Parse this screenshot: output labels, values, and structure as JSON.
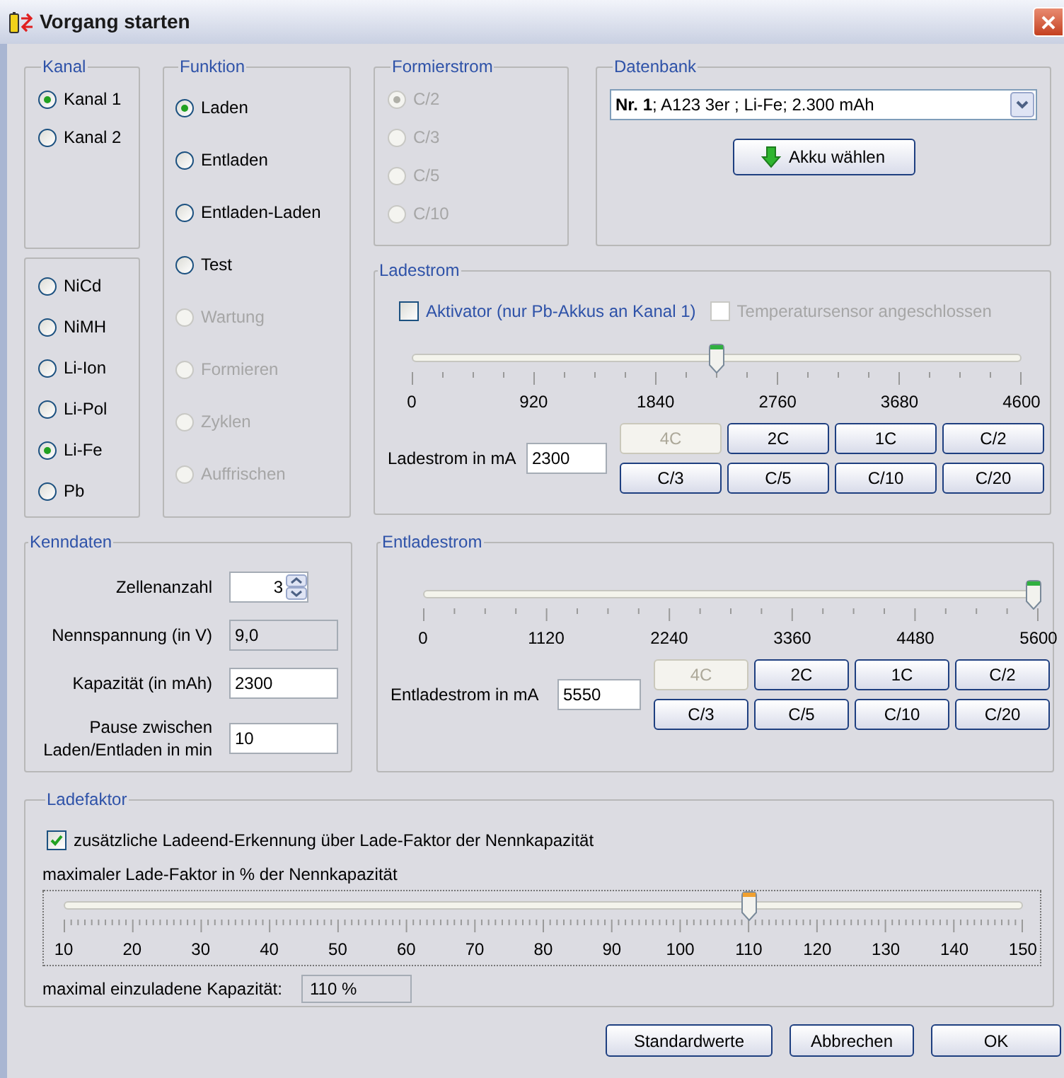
{
  "window": {
    "title": "Vorgang starten"
  },
  "kanal": {
    "title": "Kanal",
    "options": [
      {
        "label": "Kanal 1",
        "selected": true,
        "disabled": false
      },
      {
        "label": "Kanal 2",
        "selected": false,
        "disabled": false
      }
    ]
  },
  "akku_typ": {
    "options": [
      {
        "label": "NiCd",
        "selected": false,
        "disabled": false
      },
      {
        "label": "NiMH",
        "selected": false,
        "disabled": false
      },
      {
        "label": "Li-Ion",
        "selected": false,
        "disabled": false
      },
      {
        "label": "Li-Pol",
        "selected": false,
        "disabled": false
      },
      {
        "label": "Li-Fe",
        "selected": true,
        "disabled": false
      },
      {
        "label": "Pb",
        "selected": false,
        "disabled": false
      }
    ]
  },
  "funktion": {
    "title": "Funktion",
    "options": [
      {
        "label": "Laden",
        "selected": true,
        "disabled": false
      },
      {
        "label": "Entladen",
        "selected": false,
        "disabled": false
      },
      {
        "label": "Entladen-Laden",
        "selected": false,
        "disabled": false
      },
      {
        "label": "Test",
        "selected": false,
        "disabled": false
      },
      {
        "label": "Wartung",
        "selected": false,
        "disabled": true
      },
      {
        "label": "Formieren",
        "selected": false,
        "disabled": true
      },
      {
        "label": "Zyklen",
        "selected": false,
        "disabled": true
      },
      {
        "label": "Auffrischen",
        "selected": false,
        "disabled": true
      }
    ]
  },
  "formierstrom": {
    "title": "Formierstrom",
    "options": [
      {
        "label": "C/2",
        "selected": true,
        "disabled": true
      },
      {
        "label": "C/3",
        "selected": false,
        "disabled": true
      },
      {
        "label": "C/5",
        "selected": false,
        "disabled": true
      },
      {
        "label": "C/10",
        "selected": false,
        "disabled": true
      }
    ]
  },
  "datenbank": {
    "title": "Datenbank",
    "select": {
      "value": "**Nr. 1**; A123 3er ; Li-Fe; 2.300 mAh"
    },
    "button": "Akku wählen"
  },
  "ladestrom": {
    "title": "Ladestrom",
    "checkboxes": [
      {
        "label": "Aktivator (nur Pb-Akkus an Kanal 1)",
        "checked": false,
        "disabled": false
      },
      {
        "label": "Temperatursensor angeschlossen",
        "checked": false,
        "disabled": true
      }
    ],
    "slider": {
      "level": 0.5,
      "focused": false,
      "ticks": [
        "0",
        "920",
        "1840",
        "2760",
        "3680",
        "4600"
      ]
    },
    "field_label": "Ladestrom in mA",
    "value": "2300",
    "buttons": [
      {
        "label": "4C",
        "disabled": true
      },
      {
        "label": "2C",
        "disabled": false
      },
      {
        "label": "1C",
        "disabled": false
      },
      {
        "label": "C/2",
        "disabled": false
      },
      {
        "label": "C/3",
        "disabled": false
      },
      {
        "label": "C/5",
        "disabled": false
      },
      {
        "label": "C/10",
        "disabled": false
      },
      {
        "label": "C/20",
        "disabled": false
      }
    ]
  },
  "kenndaten": {
    "title": "Kenndaten",
    "fields": [
      {
        "label": "Zellenanzahl",
        "value": "3",
        "kind": "spinner"
      },
      {
        "label": "Nennspannung (in V)",
        "value": "9,0",
        "kind": "readonly"
      },
      {
        "label": "Kapazität (in mAh)",
        "value": "2300",
        "kind": "input"
      },
      {
        "label": "Pause zwischen Laden/Entladen in min",
        "value": "10",
        "kind": "input"
      }
    ]
  },
  "entladestrom": {
    "title": "Entladestrom",
    "slider": {
      "level": 0.991,
      "focused": false,
      "ticks": [
        "0",
        "1120",
        "2240",
        "3360",
        "4480",
        "5600"
      ]
    },
    "field_label": "Entladestrom in mA",
    "value": "5550",
    "buttons": [
      {
        "label": "4C",
        "disabled": true
      },
      {
        "label": "2C",
        "disabled": false
      },
      {
        "label": "1C",
        "disabled": false
      },
      {
        "label": "C/2",
        "disabled": false
      },
      {
        "label": "C/3",
        "disabled": false
      },
      {
        "label": "C/5",
        "disabled": false
      },
      {
        "label": "C/10",
        "disabled": false
      },
      {
        "label": "C/20",
        "disabled": false
      }
    ]
  },
  "ladefaktor": {
    "title": "Ladefaktor",
    "checkbox": {
      "label": "zusätzliche Ladeend-Erkennung über Lade-Faktor der Nennkapazität",
      "checked": true
    },
    "slider_label": "maximaler Lade-Faktor in % der Nennkapazität",
    "slider": {
      "level": 0.714,
      "focused": true,
      "ticks": [
        "10",
        "20",
        "30",
        "40",
        "50",
        "60",
        "70",
        "80",
        "90",
        "100",
        "110",
        "120",
        "130",
        "140",
        "150"
      ]
    },
    "result_label": "maximal einzuladene Kapazität:",
    "result_value": "110 %"
  },
  "buttons": [
    "Standardwerte",
    "Abbrechen",
    "OK"
  ]
}
